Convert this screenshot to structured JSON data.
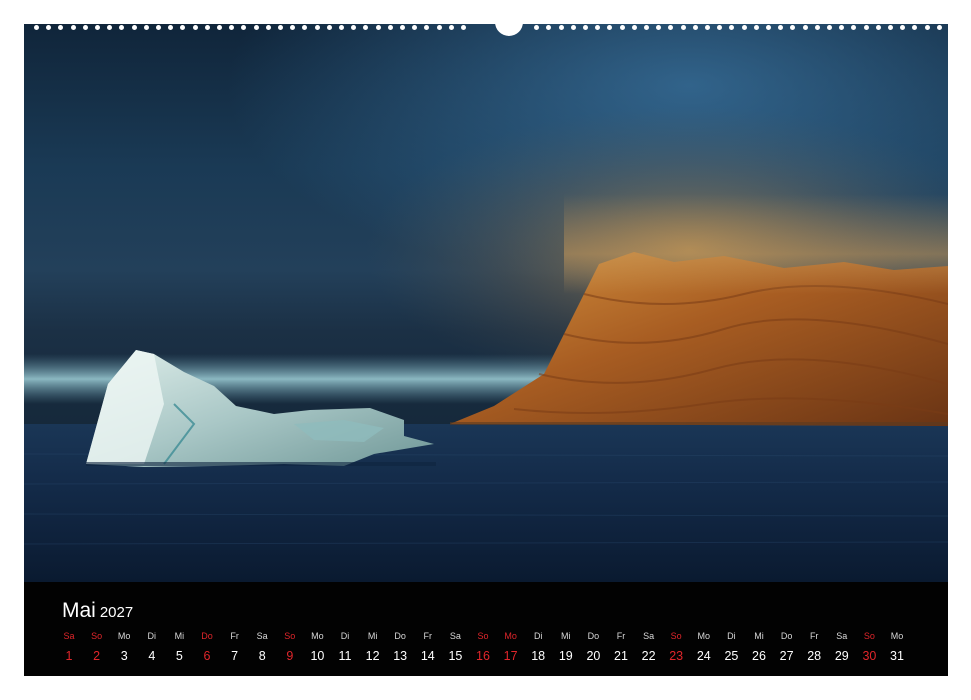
{
  "calendar": {
    "month": "Mai",
    "year": "2027",
    "days": [
      {
        "wd": "Sa",
        "n": "1",
        "red": true
      },
      {
        "wd": "So",
        "n": "2",
        "red": true
      },
      {
        "wd": "Mo",
        "n": "3",
        "red": false
      },
      {
        "wd": "Di",
        "n": "4",
        "red": false
      },
      {
        "wd": "Mi",
        "n": "5",
        "red": false
      },
      {
        "wd": "Do",
        "n": "6",
        "red": true
      },
      {
        "wd": "Fr",
        "n": "7",
        "red": false
      },
      {
        "wd": "Sa",
        "n": "8",
        "red": false
      },
      {
        "wd": "So",
        "n": "9",
        "red": true
      },
      {
        "wd": "Mo",
        "n": "10",
        "red": false
      },
      {
        "wd": "Di",
        "n": "11",
        "red": false
      },
      {
        "wd": "Mi",
        "n": "12",
        "red": false
      },
      {
        "wd": "Do",
        "n": "13",
        "red": false
      },
      {
        "wd": "Fr",
        "n": "14",
        "red": false
      },
      {
        "wd": "Sa",
        "n": "15",
        "red": false
      },
      {
        "wd": "So",
        "n": "16",
        "red": true
      },
      {
        "wd": "Mo",
        "n": "17",
        "red": true
      },
      {
        "wd": "Di",
        "n": "18",
        "red": false
      },
      {
        "wd": "Mi",
        "n": "19",
        "red": false
      },
      {
        "wd": "Do",
        "n": "20",
        "red": false
      },
      {
        "wd": "Fr",
        "n": "21",
        "red": false
      },
      {
        "wd": "Sa",
        "n": "22",
        "red": false
      },
      {
        "wd": "So",
        "n": "23",
        "red": true
      },
      {
        "wd": "Mo",
        "n": "24",
        "red": false
      },
      {
        "wd": "Di",
        "n": "25",
        "red": false
      },
      {
        "wd": "Mi",
        "n": "26",
        "red": false
      },
      {
        "wd": "Do",
        "n": "27",
        "red": false
      },
      {
        "wd": "Fr",
        "n": "28",
        "red": false
      },
      {
        "wd": "Sa",
        "n": "29",
        "red": false
      },
      {
        "wd": "So",
        "n": "30",
        "red": true
      },
      {
        "wd": "Mo",
        "n": "31",
        "red": false
      }
    ]
  },
  "colors": {
    "strip_background": "#020202",
    "weekend_red": "#e0262b",
    "sky": "#1c3a52",
    "sea": "#0f2440",
    "cliff": "#b06a28"
  },
  "photo": {
    "subject": "iceberg-and-cliff-landscape"
  }
}
